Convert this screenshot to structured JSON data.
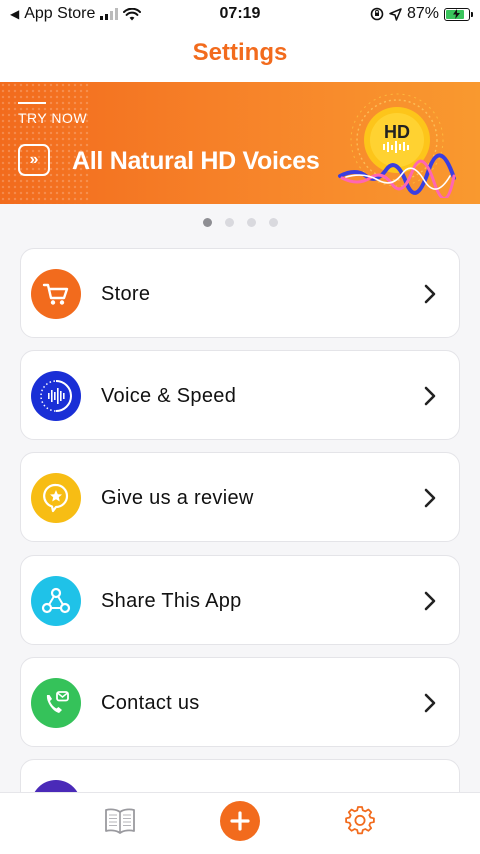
{
  "status_bar": {
    "back_app": "App Store",
    "time": "07:19",
    "battery_percent": "87%",
    "battery_level": 0.87
  },
  "header": {
    "title": "Settings"
  },
  "banner": {
    "kicker": "TRY NOW",
    "heading": "All Natural HD Voices",
    "badge": "HD",
    "slides": 4,
    "active_slide": 1
  },
  "menu": {
    "items": [
      {
        "label": "Store",
        "icon": "cart-icon",
        "color": "#f26b1d"
      },
      {
        "label": "Voice & Speed",
        "icon": "voice-wave-icon",
        "color": "#1a2fd6"
      },
      {
        "label": "Give us a review",
        "icon": "star-bubble-icon",
        "color": "#f7bd14"
      },
      {
        "label": "Share This App",
        "icon": "share-icon",
        "color": "#1fc2e8"
      },
      {
        "label": "Contact us",
        "icon": "phone-mail-icon",
        "color": "#35c25a"
      }
    ]
  },
  "tab_bar": {
    "items": [
      {
        "name": "library",
        "icon": "book-icon"
      },
      {
        "name": "add",
        "icon": "plus-icon",
        "color": "#f26b1d"
      },
      {
        "name": "settings",
        "icon": "gear-icon",
        "color": "#f26b1d"
      }
    ]
  },
  "colors": {
    "accent": "#f26b1d",
    "background": "#f6f6f8"
  }
}
